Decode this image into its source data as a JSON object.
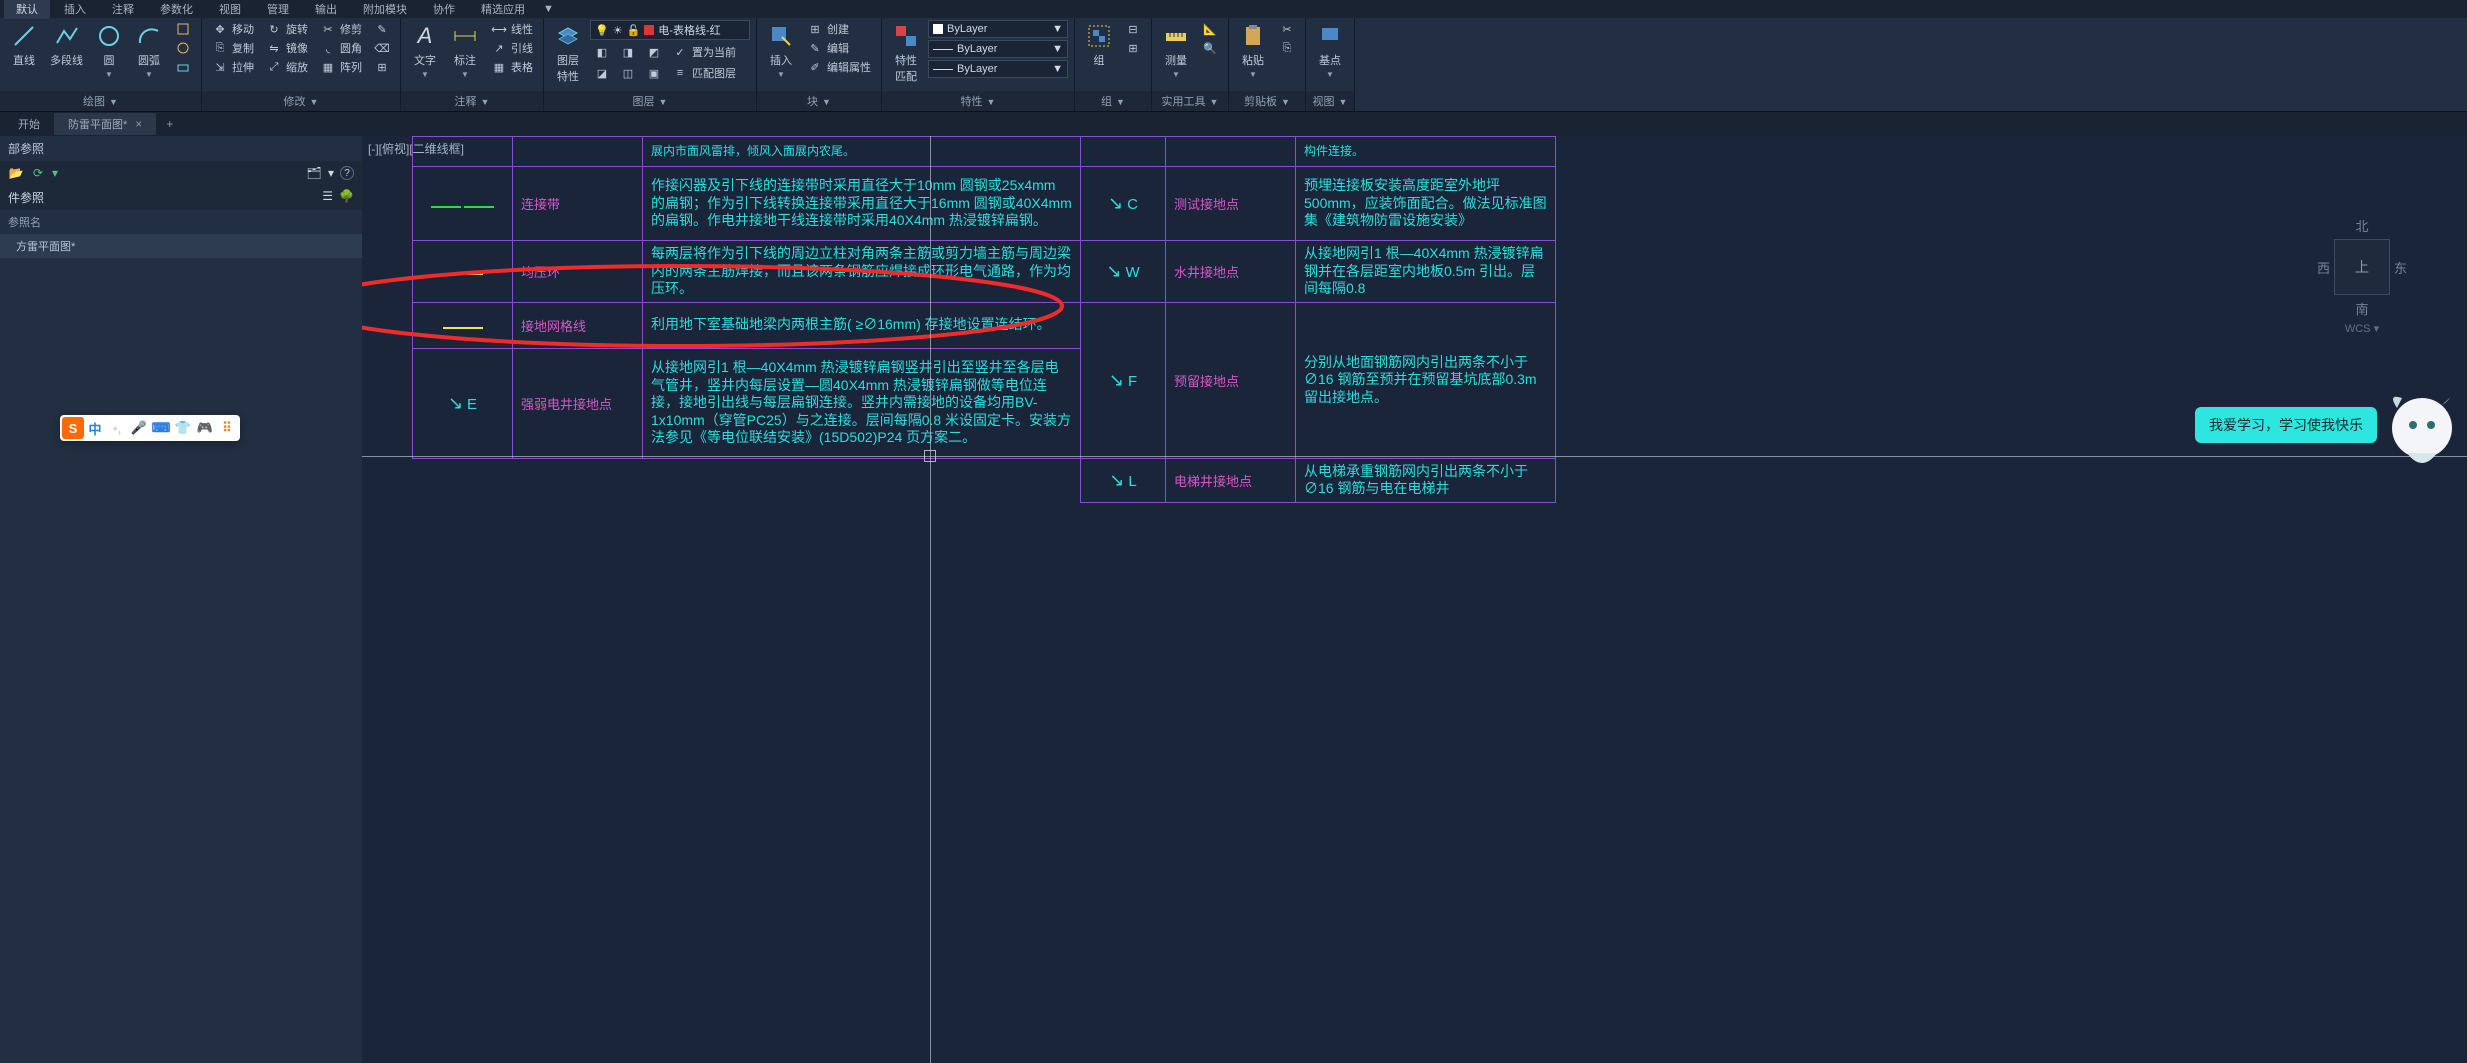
{
  "ribbon_tabs": [
    "默认",
    "插入",
    "注释",
    "参数化",
    "视图",
    "管理",
    "输出",
    "附加模块",
    "协作",
    "精选应用"
  ],
  "ribbon_tab_suffix": "▼",
  "panels": {
    "draw": {
      "title": "绘图",
      "items": [
        "直线",
        "多段线",
        "圆",
        "圆弧"
      ]
    },
    "modify": {
      "title": "修改",
      "items": [
        "移动",
        "复制",
        "拉伸",
        "旋转",
        "镜像",
        "缩放",
        "修剪",
        "圆角",
        "阵列"
      ]
    },
    "annot": {
      "title": "注释",
      "text": "文字",
      "dim": "标注",
      "table": "表格",
      "items": [
        "线性",
        "引线"
      ]
    },
    "layers": {
      "title": "图层",
      "prop": "图层\n特性",
      "current": "电-表格线-红",
      "items": [
        "置为当前",
        "匹配图层"
      ]
    },
    "block": {
      "title": "块",
      "insert": "插入",
      "items": [
        "创建",
        "编辑",
        "编辑属性"
      ]
    },
    "props": {
      "title": "特性",
      "btn": "特性\n匹配",
      "bylayer": "ByLayer"
    },
    "group": {
      "title": "组",
      "btn": "组"
    },
    "util": {
      "title": "实用工具",
      "btn": "测量"
    },
    "clip": {
      "title": "剪贴板",
      "btn": "粘贴"
    },
    "view": {
      "title": "视图",
      "btn": "基点"
    }
  },
  "file_tabs": {
    "home": "开始",
    "active": "防雷平面图*",
    "add": "+"
  },
  "sidebar": {
    "title": "部参照",
    "sub_title": "件参照",
    "col": "参照名",
    "items": [
      "方雷平面图*"
    ]
  },
  "viewport_label": "[-][俯视][二维线框]",
  "table": {
    "rows": [
      {
        "sym": "green",
        "name": "连接带",
        "desc": "作接闪器及引下线的连接带时采用直径大于10mm 圆钢或25x4mm 的扁钢；作为引下线转换连接带采用直径大于16mm 圆钢或40X4mm 的扁钢。作电井接地干线连接带时采用40X4mm 热浸镀锌扁钢。",
        "sym2": "C",
        "name2": "测试接地点",
        "desc2": "预埋连接板安装高度距室外地坪500mm，应装饰面配合。做法见标准图集《建筑物防雷设施安装》"
      },
      {
        "sym": "yellow",
        "name": "均压环",
        "desc": "每两层将作为引下线的周边立柱对角两条主筋或剪力墙主筋与周边梁内的两条主筋焊接，而且该两条钢筋应焊接成环形电气通路，作为均压环。",
        "sym2": "W",
        "name2": "水井接地点",
        "desc2": "从接地网引1 根—40X4mm 热浸镀锌扁钢并在各层距室内地板0.5m 引出。层间每隔0.8"
      },
      {
        "sym": "yellow",
        "name": "接地网格线",
        "desc": "利用地下室基础地梁内两根主筋( ≥∅16mm) 存接地设置连结环。",
        "sym2": "F",
        "name2": "预留接地点",
        "desc2": "分别从地面钢筋网内引出两条不小于∅16 钢筋至预并在预留基坑底部0.3m 留出接地点。"
      },
      {
        "sym": "E",
        "name": "强弱电井接地点",
        "desc": "从接地网引1 根—40X4mm 热浸镀锌扁钢竖井引出至竖井至各层电气管井，竖井内每层设置—圆40X4mm 热浸镀锌扁钢做等电位连接，接地引出线与每层扁钢连接。竖井内需接地的设备均用BV-1x10mm（穿管PC25）与之连接。层间每隔0.8 米设固定卡。安装方法参见《等电位联结安装》(15D502)P24 页方案二。",
        "sym2": "L",
        "name2": "电梯井接地点",
        "desc2": "从电梯承重钢筋网内引出两条不小于∅16 钢筋与电在电梯井"
      }
    ],
    "row0_top": "展内市面风雷排，倾风入面展内农尾。",
    "row0_top2": "构件连接。"
  },
  "viewcube": {
    "n": "北",
    "s": "南",
    "e": "东",
    "w": "西",
    "top": "上",
    "wcs": "WCS"
  },
  "assistant_text": "我爱学习，学习使我快乐",
  "ime": {
    "logo": "S",
    "lang": "中"
  },
  "chev": "▼"
}
